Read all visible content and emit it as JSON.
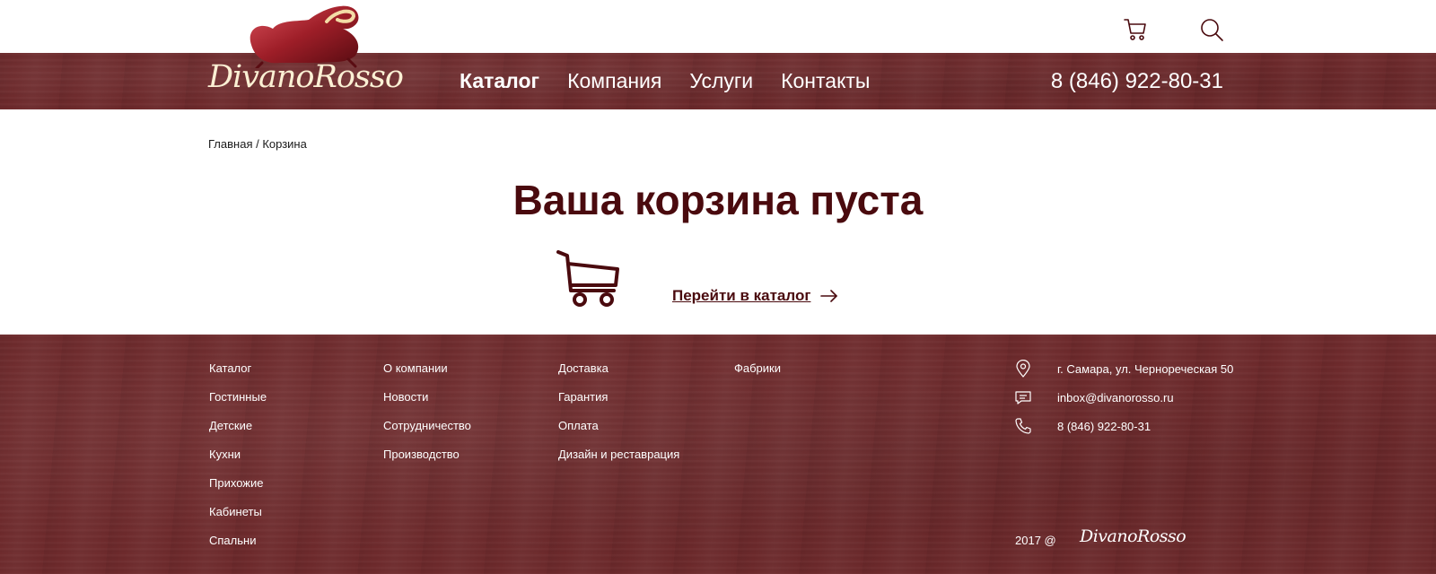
{
  "brand": {
    "name": "DivanoRosso"
  },
  "header": {
    "nav": [
      "Каталог",
      "Компания",
      "Услуги",
      "Контакты"
    ],
    "active_nav": "Каталог",
    "phone": "8 (846) 922-80-31",
    "icons": [
      "cart-icon",
      "search-icon"
    ]
  },
  "breadcrumb": {
    "home": "Главная",
    "separator": " / ",
    "current": "Корзина"
  },
  "main": {
    "title": "Ваша корзина пуста",
    "catalog_link": "Перейти в каталог"
  },
  "footer": {
    "col1": [
      "Каталог",
      "Гостинные",
      "Детские",
      "Кухни",
      "Прихожие",
      "Кабинеты",
      "Спальни"
    ],
    "col2": [
      "О компании",
      "Новости",
      "Сотрудничество",
      "Производство"
    ],
    "col3": [
      "Доставка",
      "Гарантия",
      "Оплата",
      "Дизайн и реставрация"
    ],
    "col4": [
      "Фабрики"
    ],
    "contacts": {
      "address": "г. Самара, ул. Чернореческая 50",
      "email": "inbox@divanorosso.ru",
      "phone": "8 (846) 922-80-31"
    },
    "copyright": "2017 @",
    "logo": "DivanoRosso"
  },
  "colors": {
    "wood": "#6e2a2c",
    "accent": "#4a0a0e",
    "logo_cream": "#fbf0d4"
  }
}
